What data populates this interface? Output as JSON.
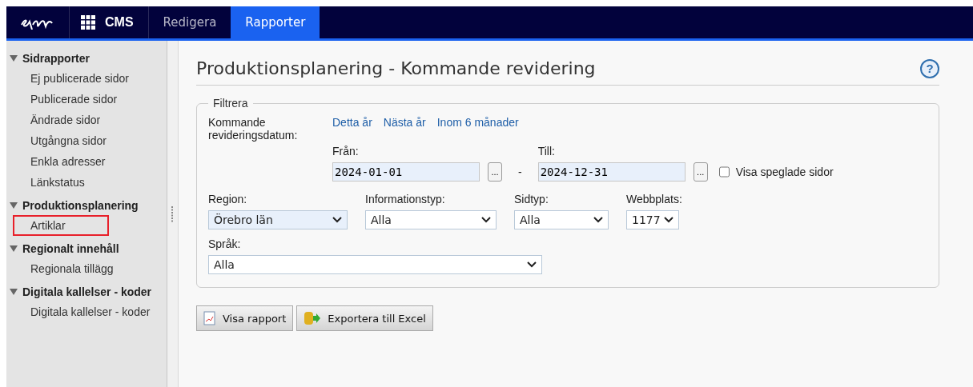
{
  "navbar": {
    "brand": "CMS",
    "tabs": [
      {
        "label": "Redigera",
        "selected": false
      },
      {
        "label": "Rapporter",
        "selected": true
      }
    ]
  },
  "sidebar": {
    "groups": [
      {
        "title": "Sidrapporter",
        "expanded": true,
        "items": [
          {
            "label": "Ej publicerade sidor",
            "outlined": false
          },
          {
            "label": "Publicerade sidor",
            "outlined": false
          },
          {
            "label": "Ändrade sidor",
            "outlined": false
          },
          {
            "label": "Utgångna sidor",
            "outlined": false
          },
          {
            "label": "Enkla adresser",
            "outlined": false
          },
          {
            "label": "Länkstatus",
            "outlined": false
          }
        ]
      },
      {
        "title": "Produktionsplanering",
        "expanded": true,
        "items": [
          {
            "label": "Artiklar",
            "outlined": true
          }
        ]
      },
      {
        "title": "Regionalt innehåll",
        "expanded": true,
        "items": [
          {
            "label": "Regionala tillägg",
            "outlined": false
          }
        ]
      },
      {
        "title": "Digitala kallelser - koder",
        "expanded": true,
        "items": [
          {
            "label": "Digitala kallelser - koder",
            "outlined": false
          }
        ]
      }
    ]
  },
  "page": {
    "title": "Produktionsplanering - Kommande revidering",
    "help": "?"
  },
  "filter": {
    "legend": "Filtrera",
    "date_label": "Kommande revideringsdatum:",
    "quick_links": [
      "Detta år",
      "Nästa år",
      "Inom 6 månader"
    ],
    "from": {
      "label": "Från:",
      "value": "2024-01-01",
      "picker": "..."
    },
    "separator": "-",
    "to": {
      "label": "Till:",
      "value": "2024-12-31",
      "picker": "..."
    },
    "mirrored": {
      "label": "Visa speglade sidor",
      "checked": false
    },
    "selects": [
      {
        "label": "Region:",
        "value": "Örebro län",
        "highlighted": true
      },
      {
        "label": "Informationstyp:",
        "value": "Alla",
        "highlighted": false
      },
      {
        "label": "Sidtyp:",
        "value": "Alla",
        "highlighted": false
      },
      {
        "label": "Webbplats:",
        "value": "1177",
        "highlighted": false
      }
    ],
    "language": {
      "label": "Språk:",
      "value": "Alla"
    }
  },
  "buttons": [
    {
      "label": "Visa rapport",
      "kind": "report"
    },
    {
      "label": "Exportera till Excel",
      "kind": "excel"
    }
  ]
}
